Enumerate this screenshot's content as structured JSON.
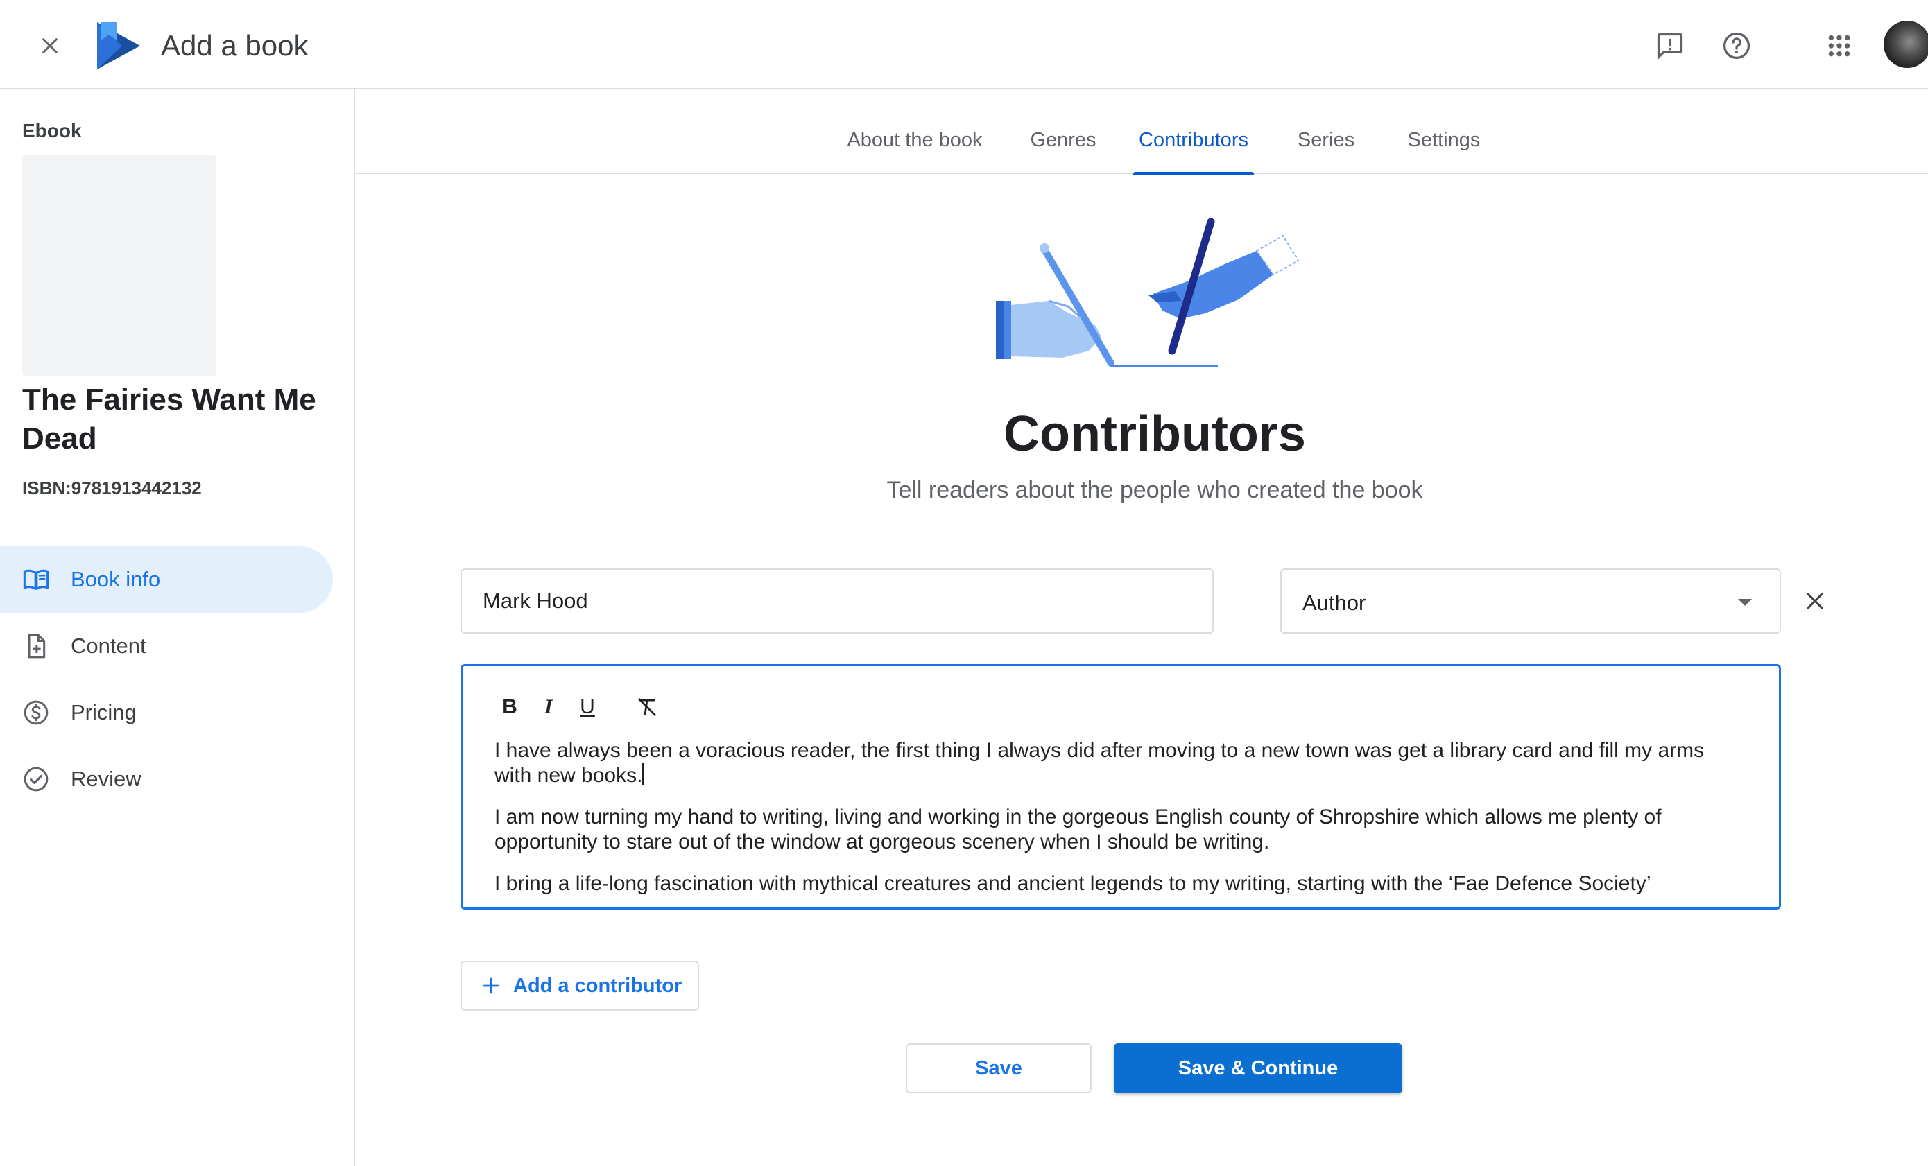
{
  "header": {
    "title": "Add a book",
    "icons": [
      "close-icon",
      "play-books-logo",
      "feedback-icon",
      "help-icon",
      "apps-grid-icon",
      "avatar"
    ]
  },
  "sidebar": {
    "format": "Ebook",
    "book_title": "The Fairies Want Me Dead",
    "isbn": "ISBN:9781913442132",
    "items": [
      {
        "label": "Book info",
        "icon": "book-open-icon",
        "active": true
      },
      {
        "label": "Content",
        "icon": "file-add-icon",
        "active": false
      },
      {
        "label": "Pricing",
        "icon": "dollar-circle-icon",
        "active": false
      },
      {
        "label": "Review",
        "icon": "check-circle-icon",
        "active": false
      }
    ]
  },
  "tabs": [
    {
      "label": "About the book",
      "active": false
    },
    {
      "label": "Genres",
      "active": false
    },
    {
      "label": "Contributors",
      "active": true
    },
    {
      "label": "Series",
      "active": false
    },
    {
      "label": "Settings",
      "active": false
    }
  ],
  "main": {
    "title": "Contributors",
    "subtitle": "Tell readers about the people who created the book",
    "contributor": {
      "name": "Mark Hood",
      "role": "Author",
      "toolbar": {
        "bold": "B",
        "italic": "I",
        "underline": "U"
      },
      "bio": [
        "I have always been a voracious reader, the first thing I always did after moving to a new town was get a library card and fill my arms with new books.",
        "I am now turning my hand to writing, living and working in the gorgeous English county of Shropshire which allows me plenty of opportunity to stare out of the window at gorgeous scenery when I should be writing.",
        "I bring a life-long fascination with mythical creatures and ancient legends to my writing, starting with the ‘Fae Defence Society’"
      ]
    },
    "add_contributor_label": "Add a contributor",
    "save_label": "Save",
    "save_continue_label": "Save & Continue"
  },
  "colors": {
    "accent": "#1a73e8",
    "primary_button": "#0b6fd1",
    "active_nav_bg": "#e3f0fc",
    "border": "#dadce0"
  }
}
